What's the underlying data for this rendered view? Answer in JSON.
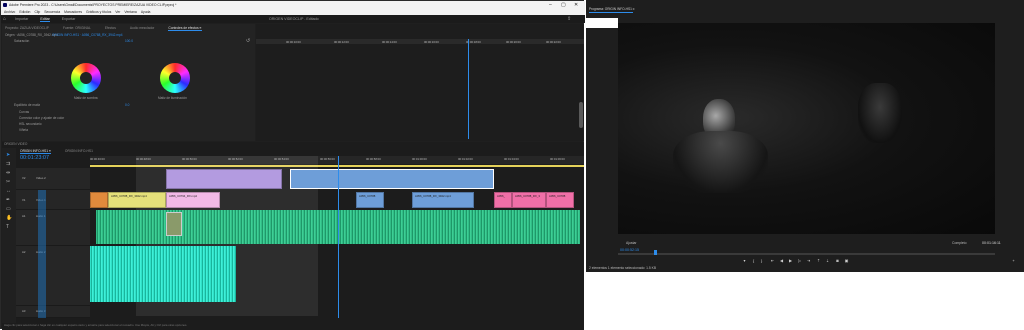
{
  "app_title": "Adobe Premiere Pro 2023 - C:\\Users\\Gmail\\Documents\\PROYECTOS PREMIERE\\ZAZUA VIDEO CLIP.prproj *",
  "menu": [
    "Archivo",
    "Edición",
    "Clip",
    "Secuencia",
    "Marcadores",
    "Gráficos y títulos",
    "Ver",
    "Ventana",
    "Ayuda"
  ],
  "workspaces": {
    "items": [
      "Importar",
      "Editar",
      "Exportar"
    ],
    "center": "ORIGEN VIDEOCLIP",
    "center_suffix": "Editado"
  },
  "source_tabs": [
    "Proyecto: ZAZUA VIDEOCLIP",
    "Fuente: ORIGINAL",
    "Efectos",
    "Audio mezclador",
    "Controles de efectos ≡"
  ],
  "effect_controls": {
    "source": "Origen · A056_C0788_RX_3942.mp4",
    "sequence": "ORIGIN INFO-HS1 · A056_C0788_RX_3942.mp4",
    "saturation_label": "Saturación",
    "saturation_value": "100.0",
    "shadow_label": "Matiz de sombra",
    "highlight_label": "Matiz de iluminación",
    "balance_label": "Equilibrio de matiz",
    "balance_value": "0.0",
    "rows": [
      "Curvas",
      "Corrector color y ajuste de color",
      "HSL secundario",
      "Viñeta"
    ]
  },
  "timecodes_top": [
    "00:00:10:00",
    "00:00:12:00",
    "00:00:14:00",
    "00:00:16:00",
    "00:00:18:00",
    "00:00:20:00",
    "00:00:22:00"
  ],
  "timeline": {
    "tab": "ORIGIN INFO-HS1 ≡",
    "tab2": "ORIGIN INFO-HS1",
    "panel_label": "ORIGEN VIDEO",
    "timecode": "00:01:23:07",
    "ruler": [
      "00:00:46:00",
      "00:00:48:00",
      "00:00:50:00",
      "00:00:52:00",
      "00:00:54:00",
      "00:00:56:00",
      "00:00:58:00",
      "00:01:00:00",
      "00:01:02:00",
      "00:01:04:00",
      "00:01:06:00"
    ],
    "tracks": [
      {
        "id": "V2",
        "label": "Vídeo 2"
      },
      {
        "id": "V1",
        "label": "Vídeo 1"
      },
      {
        "id": "A1",
        "label": "Audio 1"
      },
      {
        "id": "A2",
        "label": "Audio 2"
      },
      {
        "id": "A3",
        "label": "Audio 3"
      }
    ],
    "clips_v1": [
      "A056_C0788_RX_3942.mp4",
      "A056_C0794_RX.mp4",
      "A056_C0788",
      "A056_C0788_RX_3942.mp4",
      "A056_",
      "A056_C0788_RX_3",
      "A056_C0788"
    ],
    "status": "Haga clic para seleccionar o haga clic en cualquier espacio vacío y arrastre para seleccionar el recuadro. Use Mayús, Alt y Ctrl para otras opciones."
  },
  "program": {
    "title": "Programa: ORIGIN INFO-HS1 ≡",
    "timecode_left": "00:00:52:15",
    "fit": "Ajustar",
    "quality": "Completo",
    "timecode_right": "00:01:16:11",
    "status": "2 elementos     1 elemento seleccionado: 1.5 KB"
  },
  "colors": {
    "accent": "#2d8ceb",
    "v1_yellow": "#e5e07a",
    "v1_pink": "#f06fa7",
    "v2_purple": "#b39be0",
    "v2_blue": "#6e9ed8",
    "audio_green": "#2fc08a"
  }
}
